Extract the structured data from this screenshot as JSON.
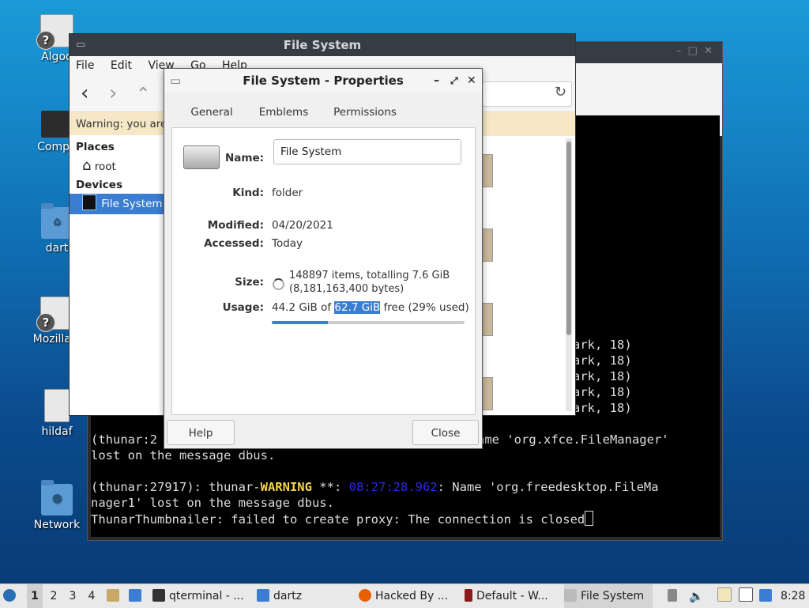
{
  "desktop": {
    "icons": [
      {
        "label": "Algod"
      },
      {
        "label": "Compu"
      },
      {
        "label": "dart"
      },
      {
        "label": "Mozilla F"
      },
      {
        "label": "hildaf"
      },
      {
        "label": "Network"
      }
    ]
  },
  "terminal": {
    "lines_ark": [
      "ark, 18)",
      "ark, 18)",
      "ark, 18)",
      "ark, 18)",
      "ark, 18)"
    ],
    "line1_a": "(thunar:2",
    "line1_b": "ame 'org.xfce.FileManager'",
    "line2": "lost on the message dbus.",
    "line4_prefix": "(thunar:27917): thunar-",
    "line4_warn": "WARNING",
    "line4_mid": " **: ",
    "line4_ts": "08:27:28.962",
    "line4_suffix": ": Name 'org.freedesktop.FileMa",
    "line5": "nager1' lost on the message dbus.",
    "line6": "ThunarThumbnailer: failed to create proxy: The connection is closed"
  },
  "thunar": {
    "title": "File System",
    "menu": [
      "File",
      "Edit",
      "View",
      "Go",
      "Help"
    ],
    "warning": "Warning: you are",
    "sidebar": {
      "places_header": "Places",
      "root_label": "root",
      "devices_header": "Devices",
      "fs_label": "File System"
    }
  },
  "dialog": {
    "title": "File System - Properties",
    "tabs": [
      "General",
      "Emblems",
      "Permissions"
    ],
    "name_label": "Name:",
    "name_value": "File System",
    "kind_label": "Kind:",
    "kind_value": "folder",
    "modified_label": "Modified:",
    "modified_value": "04/20/2021",
    "accessed_label": "Accessed:",
    "accessed_value": "Today",
    "size_label": "Size:",
    "size_line1": "148897 items, totalling 7.6 GiB",
    "size_line2": "(8,181,163,400 bytes)",
    "usage_label": "Usage:",
    "usage_pre": "44.2 GiB of ",
    "usage_hl": "62.7 GiB",
    "usage_post": " free (29% used)",
    "usage_fraction": 0.29,
    "help_button": "Help",
    "close_button": "Close"
  },
  "taskbar": {
    "workspaces": [
      "1",
      "2",
      "3",
      "4"
    ],
    "tasks": [
      "qterminal - ...",
      "dartz",
      "Hacked By ...",
      "Default - W...",
      "File System"
    ],
    "clock": "8:28"
  }
}
